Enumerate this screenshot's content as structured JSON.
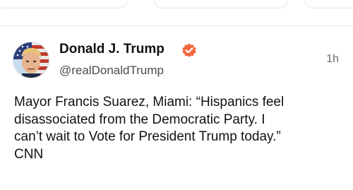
{
  "post": {
    "author_name": "Donald J. Trump",
    "handle": "@realDonaldTrump",
    "timestamp": "1h",
    "text": "Mayor Francis Suarez, Miami: “Hispanics feel\ndisassociated from the Democratic Party. I\ncan’t wait to Vote for President Trump today.”\nCNN"
  },
  "icons": {
    "verified": "verified-badge-icon",
    "avatar": "profile-avatar"
  },
  "colors": {
    "verified_badge": "#f2683c",
    "text": "#111111",
    "handle": "#4a4a4a",
    "timestamp": "#6b6b6b"
  }
}
